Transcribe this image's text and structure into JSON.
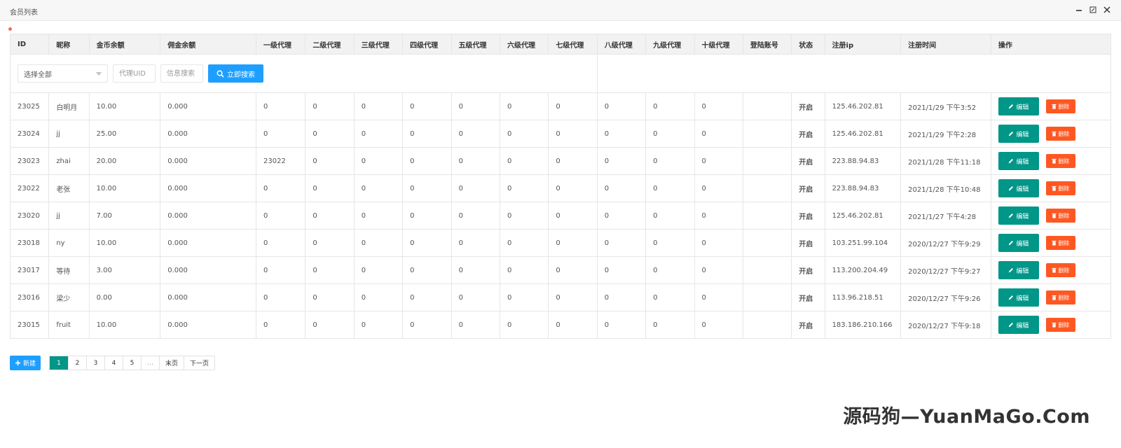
{
  "window": {
    "title": "会员列表"
  },
  "table": {
    "headers": [
      "ID",
      "昵称",
      "金币余额",
      "佣金余额",
      "一级代理",
      "二级代理",
      "三级代理",
      "四级代理",
      "五级代理",
      "六级代理",
      "七级代理",
      "八级代理",
      "九级代理",
      "十级代理",
      "登陆账号",
      "状态",
      "注册ip",
      "注册时间",
      "操作"
    ],
    "filter": {
      "select_value": "选择全部",
      "agent_uid_placeholder": "代理UID",
      "search_placeholder": "信息搜索",
      "search_label": "立即搜索"
    },
    "rows": [
      [
        "23025",
        "白明月",
        "10.00",
        "0.000",
        "0",
        "0",
        "0",
        "0",
        "0",
        "0",
        "0",
        "0",
        "0",
        "0",
        "",
        "开启",
        "125.46.202.81",
        "2021/1/29 下午3:52"
      ],
      [
        "23024",
        "jj",
        "25.00",
        "0.000",
        "0",
        "0",
        "0",
        "0",
        "0",
        "0",
        "0",
        "0",
        "0",
        "0",
        "",
        "开启",
        "125.46.202.81",
        "2021/1/29 下午2:28"
      ],
      [
        "23023",
        "zhai",
        "20.00",
        "0.000",
        "23022",
        "0",
        "0",
        "0",
        "0",
        "0",
        "0",
        "0",
        "0",
        "0",
        "",
        "开启",
        "223.88.94.83",
        "2021/1/28 下午11:18"
      ],
      [
        "23022",
        "老张",
        "10.00",
        "0.000",
        "0",
        "0",
        "0",
        "0",
        "0",
        "0",
        "0",
        "0",
        "0",
        "0",
        "",
        "开启",
        "223.88.94.83",
        "2021/1/28 下午10:48"
      ],
      [
        "23020",
        "jj",
        "7.00",
        "0.000",
        "0",
        "0",
        "0",
        "0",
        "0",
        "0",
        "0",
        "0",
        "0",
        "0",
        "",
        "开启",
        "125.46.202.81",
        "2021/1/27 下午4:28"
      ],
      [
        "23018",
        "ny",
        "10.00",
        "0.000",
        "0",
        "0",
        "0",
        "0",
        "0",
        "0",
        "0",
        "0",
        "0",
        "0",
        "",
        "开启",
        "103.251.99.104",
        "2020/12/27 下午9:29"
      ],
      [
        "23017",
        "等待",
        "3.00",
        "0.000",
        "0",
        "0",
        "0",
        "0",
        "0",
        "0",
        "0",
        "0",
        "0",
        "0",
        "",
        "开启",
        "113.200.204.49",
        "2020/12/27 下午9:27"
      ],
      [
        "23016",
        "梁少",
        "0.00",
        "0.000",
        "0",
        "0",
        "0",
        "0",
        "0",
        "0",
        "0",
        "0",
        "0",
        "0",
        "",
        "开启",
        "113.96.218.51",
        "2020/12/27 下午9:26"
      ],
      [
        "23015",
        "fruit",
        "10.00",
        "0.000",
        "0",
        "0",
        "0",
        "0",
        "0",
        "0",
        "0",
        "0",
        "0",
        "0",
        "",
        "开启",
        "183.186.210.166",
        "2020/12/27 下午9:18"
      ]
    ],
    "actions": {
      "edit_label": "编辑",
      "delete_label": "删除"
    }
  },
  "bottom": {
    "new_label": "新建",
    "pages": [
      "1",
      "2",
      "3",
      "4",
      "5",
      "…",
      "末页",
      "下一页"
    ],
    "current_page": "1"
  },
  "colors": {
    "primary": "#1e9fff",
    "teal": "#009688",
    "danger": "#ff5722",
    "status_on": "#5fb878"
  },
  "watermark": "源码狗—YuanMaGo.Com"
}
